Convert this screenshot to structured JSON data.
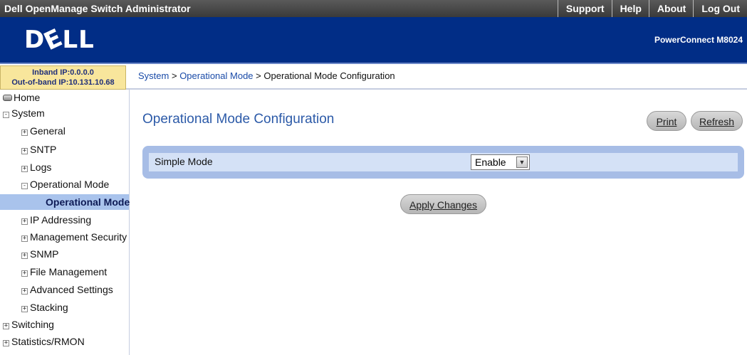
{
  "app": {
    "title": "Dell OpenManage Switch Administrator",
    "links": [
      "Support",
      "Help",
      "About",
      "Log Out"
    ]
  },
  "brand": {
    "logo_text": "DELL",
    "product": "PowerConnect M8024"
  },
  "ip_info": {
    "inband": "Inband IP:0.0.0.0",
    "outofband": "Out-of-band IP:10.131.10.68"
  },
  "breadcrumb": {
    "items": [
      "System",
      "Operational Mode",
      "Operational Mode Configuration"
    ],
    "separator": ">"
  },
  "sidebar": {
    "items": [
      {
        "label": "Home",
        "icon": "home-icon",
        "expander": ""
      },
      {
        "label": "System",
        "expander": "-"
      },
      {
        "label": "General",
        "expander": "+"
      },
      {
        "label": "SNTP",
        "expander": "+"
      },
      {
        "label": "Logs",
        "expander": "+"
      },
      {
        "label": "Operational Mode",
        "expander": "-"
      },
      {
        "label": "Operational Mode",
        "expander": "",
        "selected": true
      },
      {
        "label": "IP Addressing",
        "expander": "+"
      },
      {
        "label": "Management Security",
        "expander": "+"
      },
      {
        "label": "SNMP",
        "expander": "+"
      },
      {
        "label": "File Management",
        "expander": "+"
      },
      {
        "label": "Advanced Settings",
        "expander": "+"
      },
      {
        "label": "Stacking",
        "expander": "+"
      },
      {
        "label": "Switching",
        "expander": "+"
      },
      {
        "label": "Statistics/RMON",
        "expander": "+"
      }
    ]
  },
  "main": {
    "page_title": "Operational Mode Configuration",
    "print_label": "Print",
    "refresh_label": "Refresh",
    "form": {
      "simple_mode_label": "Simple Mode",
      "simple_mode_value": "Enable"
    },
    "apply_label": "Apply Changes"
  },
  "colors": {
    "brand_blue": "#012d86",
    "title_blue": "#2c5aa8",
    "panel_blue": "#a7bde6",
    "row_blue": "#d4e1f6",
    "selected_bg": "#a9c3ec",
    "ip_box_bg": "#f8e69c"
  }
}
